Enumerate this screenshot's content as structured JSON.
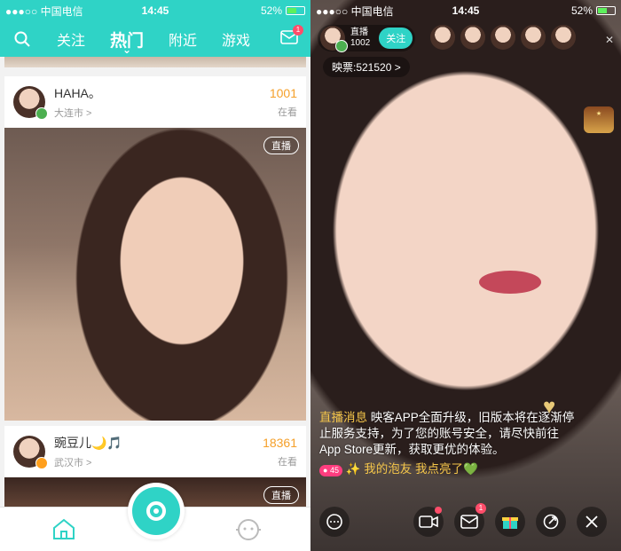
{
  "status_bar": {
    "carrier": "●●●○○ 中国电信",
    "time": "14:45",
    "battery": "52%",
    "battery_level": 0.52
  },
  "left": {
    "nav": {
      "tabs": [
        "关注",
        "热门",
        "附近",
        "游戏"
      ],
      "active": "热门",
      "mail_badge": "1"
    },
    "feed": [
      {
        "name": "HAHA。",
        "city": "大连市 >",
        "count": "1001",
        "count_label": "在看",
        "tag": "直播"
      },
      {
        "name": "豌豆儿🌙🎵",
        "city": "武汉市 >",
        "count": "18361",
        "count_label": "在看",
        "tag": "直播"
      }
    ]
  },
  "right": {
    "host": {
      "label": "直播",
      "id": "1002",
      "follow": "关注"
    },
    "votes": "映票:521520 >",
    "chat": {
      "system_prefix": "直播消息",
      "system_body": "映客APP全面升级，旧版本将在逐渐停止服务支持，为了您的账号安全，请尽快前往App Store更新，获取更优的体验。",
      "user_level": "45",
      "user_message": "✨ 我的泡友 我点亮了💚"
    },
    "mail_badge": "1"
  },
  "colors": {
    "accent": "#2fd3c6",
    "count": "#f5a02a",
    "badge": "#ff4d6a"
  }
}
